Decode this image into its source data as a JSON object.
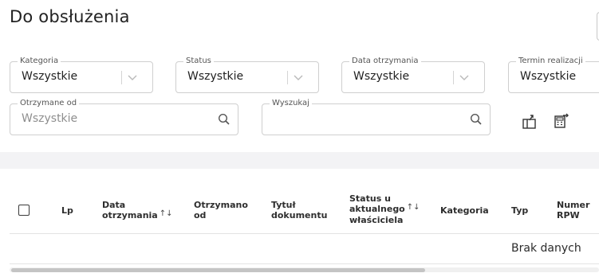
{
  "page": {
    "title": "Do obsłużenia"
  },
  "filters": {
    "kategoria": {
      "label": "Kategoria",
      "value": "Wszystkie"
    },
    "status": {
      "label": "Status",
      "value": "Wszystkie"
    },
    "data_otrzymania": {
      "label": "Data otrzymania",
      "value": "Wszystkie"
    },
    "termin_realizacji": {
      "label": "Termin realizacji",
      "value": "Wszystkie"
    },
    "otrzymane_od": {
      "label": "Otrzymane od",
      "placeholder": "Wszystkie"
    },
    "wyszukaj": {
      "label": "Wyszukaj",
      "value": ""
    }
  },
  "toolbar": {
    "icons": [
      "export-icon",
      "calculator-export-icon"
    ]
  },
  "table": {
    "columns": {
      "lp": "Lp",
      "data_otrzymania_1": "Data",
      "data_otrzymania_2": "otrzymania",
      "otrzymano_od_1": "Otrzymano",
      "otrzymano_od_2": "od",
      "tytul_1": "Tytuł",
      "tytul_2": "dokumentu",
      "status_1": "Status u",
      "status_2": "aktualnego",
      "status_3": "właściciela",
      "kategoria": "Kategoria",
      "typ": "Typ",
      "numer_1": "Numer",
      "numer_2": "RPW"
    },
    "sort_glyph": "↑↓",
    "empty_text": "Brak danych"
  },
  "colors": {
    "border": "#cfcfcf",
    "band": "#f3f3f5",
    "text": "#2b2b2b"
  }
}
